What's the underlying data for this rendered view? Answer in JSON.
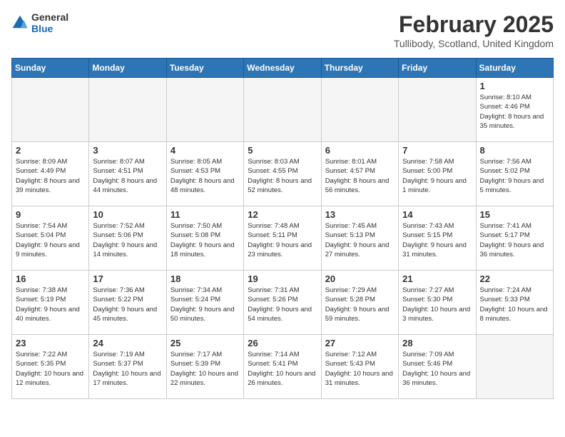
{
  "logo": {
    "general": "General",
    "blue": "Blue"
  },
  "header": {
    "title": "February 2025",
    "location": "Tullibody, Scotland, United Kingdom"
  },
  "weekdays": [
    "Sunday",
    "Monday",
    "Tuesday",
    "Wednesday",
    "Thursday",
    "Friday",
    "Saturday"
  ],
  "weeks": [
    [
      {
        "day": "",
        "info": ""
      },
      {
        "day": "",
        "info": ""
      },
      {
        "day": "",
        "info": ""
      },
      {
        "day": "",
        "info": ""
      },
      {
        "day": "",
        "info": ""
      },
      {
        "day": "",
        "info": ""
      },
      {
        "day": "1",
        "info": "Sunrise: 8:10 AM\nSunset: 4:46 PM\nDaylight: 8 hours and 35 minutes."
      }
    ],
    [
      {
        "day": "2",
        "info": "Sunrise: 8:09 AM\nSunset: 4:49 PM\nDaylight: 8 hours and 39 minutes."
      },
      {
        "day": "3",
        "info": "Sunrise: 8:07 AM\nSunset: 4:51 PM\nDaylight: 8 hours and 44 minutes."
      },
      {
        "day": "4",
        "info": "Sunrise: 8:05 AM\nSunset: 4:53 PM\nDaylight: 8 hours and 48 minutes."
      },
      {
        "day": "5",
        "info": "Sunrise: 8:03 AM\nSunset: 4:55 PM\nDaylight: 8 hours and 52 minutes."
      },
      {
        "day": "6",
        "info": "Sunrise: 8:01 AM\nSunset: 4:57 PM\nDaylight: 8 hours and 56 minutes."
      },
      {
        "day": "7",
        "info": "Sunrise: 7:58 AM\nSunset: 5:00 PM\nDaylight: 9 hours and 1 minute."
      },
      {
        "day": "8",
        "info": "Sunrise: 7:56 AM\nSunset: 5:02 PM\nDaylight: 9 hours and 5 minutes."
      }
    ],
    [
      {
        "day": "9",
        "info": "Sunrise: 7:54 AM\nSunset: 5:04 PM\nDaylight: 9 hours and 9 minutes."
      },
      {
        "day": "10",
        "info": "Sunrise: 7:52 AM\nSunset: 5:06 PM\nDaylight: 9 hours and 14 minutes."
      },
      {
        "day": "11",
        "info": "Sunrise: 7:50 AM\nSunset: 5:08 PM\nDaylight: 9 hours and 18 minutes."
      },
      {
        "day": "12",
        "info": "Sunrise: 7:48 AM\nSunset: 5:11 PM\nDaylight: 9 hours and 23 minutes."
      },
      {
        "day": "13",
        "info": "Sunrise: 7:45 AM\nSunset: 5:13 PM\nDaylight: 9 hours and 27 minutes."
      },
      {
        "day": "14",
        "info": "Sunrise: 7:43 AM\nSunset: 5:15 PM\nDaylight: 9 hours and 31 minutes."
      },
      {
        "day": "15",
        "info": "Sunrise: 7:41 AM\nSunset: 5:17 PM\nDaylight: 9 hours and 36 minutes."
      }
    ],
    [
      {
        "day": "16",
        "info": "Sunrise: 7:38 AM\nSunset: 5:19 PM\nDaylight: 9 hours and 40 minutes."
      },
      {
        "day": "17",
        "info": "Sunrise: 7:36 AM\nSunset: 5:22 PM\nDaylight: 9 hours and 45 minutes."
      },
      {
        "day": "18",
        "info": "Sunrise: 7:34 AM\nSunset: 5:24 PM\nDaylight: 9 hours and 50 minutes."
      },
      {
        "day": "19",
        "info": "Sunrise: 7:31 AM\nSunset: 5:26 PM\nDaylight: 9 hours and 54 minutes."
      },
      {
        "day": "20",
        "info": "Sunrise: 7:29 AM\nSunset: 5:28 PM\nDaylight: 9 hours and 59 minutes."
      },
      {
        "day": "21",
        "info": "Sunrise: 7:27 AM\nSunset: 5:30 PM\nDaylight: 10 hours and 3 minutes."
      },
      {
        "day": "22",
        "info": "Sunrise: 7:24 AM\nSunset: 5:33 PM\nDaylight: 10 hours and 8 minutes."
      }
    ],
    [
      {
        "day": "23",
        "info": "Sunrise: 7:22 AM\nSunset: 5:35 PM\nDaylight: 10 hours and 12 minutes."
      },
      {
        "day": "24",
        "info": "Sunrise: 7:19 AM\nSunset: 5:37 PM\nDaylight: 10 hours and 17 minutes."
      },
      {
        "day": "25",
        "info": "Sunrise: 7:17 AM\nSunset: 5:39 PM\nDaylight: 10 hours and 22 minutes."
      },
      {
        "day": "26",
        "info": "Sunrise: 7:14 AM\nSunset: 5:41 PM\nDaylight: 10 hours and 26 minutes."
      },
      {
        "day": "27",
        "info": "Sunrise: 7:12 AM\nSunset: 5:43 PM\nDaylight: 10 hours and 31 minutes."
      },
      {
        "day": "28",
        "info": "Sunrise: 7:09 AM\nSunset: 5:46 PM\nDaylight: 10 hours and 36 minutes."
      },
      {
        "day": "",
        "info": ""
      }
    ]
  ]
}
